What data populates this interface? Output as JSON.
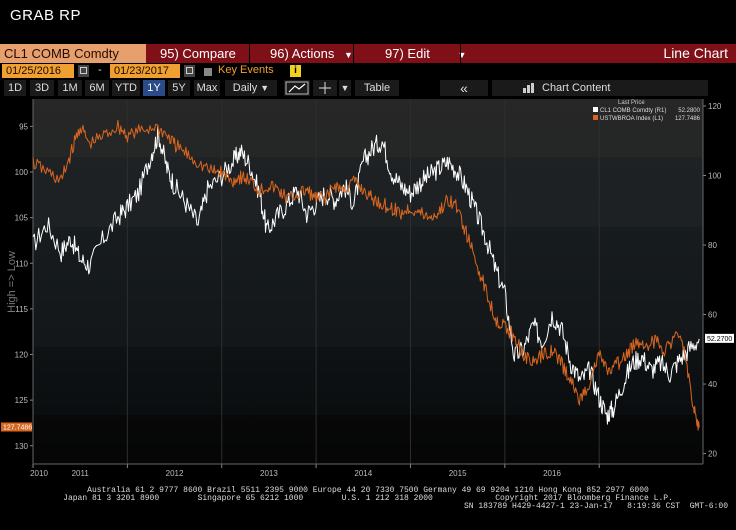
{
  "title": "GRAB RP",
  "command_bar": {
    "ticker": "CL1 COMB Comdty",
    "compare_num": "95)",
    "compare_label": "Compare",
    "actions_num": "96)",
    "actions_label": "Actions",
    "edit_num": "97)",
    "edit_label": "Edit",
    "view_label": "Line Chart"
  },
  "date_row": {
    "start_date": "01/25/2016",
    "end_date": "01/23/2017",
    "dash": "-",
    "key_events_label": "Key Events",
    "info_icon_glyph": "i"
  },
  "toolbar": {
    "ranges": [
      "1D",
      "3D",
      "1M",
      "6M",
      "YTD",
      "1Y",
      "5Y",
      "Max"
    ],
    "active_range": "1Y",
    "frequency": "Daily",
    "table_label": "Table",
    "collapse_glyph": "«",
    "chart_content_label": "Chart Content"
  },
  "legend": {
    "header": "Last Price",
    "items": [
      {
        "label": "CL1 COMB Comdty (R1)",
        "value": "52.2800",
        "color": "#ffffff"
      },
      {
        "label": "USTWBROA Index (L1)",
        "value": "127.7486",
        "color": "#d9661f"
      }
    ]
  },
  "axis_title_left": "High => Low",
  "last_value_tags": {
    "left": "127.7486",
    "right": "52.2700"
  },
  "footer": {
    "line1": "Australia 61 2 9777 8600 Brazil 5511 2395 9000 Europe 44 20 7330 7500 Germany 49 69 9204 1210 Hong Kong 852 2977 6000",
    "line2": "Japan 81 3 3201 8900        Singapore 65 6212 1000        U.S. 1 212 318 2000             Copyright 2017 Bloomberg Finance L.P.",
    "line3": "SN 183789 H429-4427-1 23-Jan-17   8:19:36 CST  GMT-6:00"
  },
  "colors": {
    "cmd_bar": "#7f1018",
    "ticker_bg": "#e6a06e",
    "date_bg": "#f0a030",
    "series_oil": "#ffffff",
    "series_dollar": "#d9661f"
  },
  "chart_data": {
    "type": "line",
    "x_ticks": [
      "2010",
      "2011",
      "2012",
      "2013",
      "2014",
      "2015",
      "2016"
    ],
    "left_axis": {
      "label": "High => Low",
      "inverted": true,
      "ticks": [
        95,
        100,
        105,
        110,
        115,
        120,
        125,
        130
      ],
      "range": [
        92,
        132
      ]
    },
    "right_axis": {
      "ticks": [
        20,
        40,
        60,
        80,
        100,
        120
      ],
      "range": [
        17,
        122
      ]
    },
    "series": [
      {
        "name": "CL1 COMB Comdty (R1)",
        "axis": "right",
        "color": "#ffffff",
        "x": [
          2010.0,
          2010.15,
          2010.3,
          2010.4,
          2010.5,
          2010.6,
          2010.75,
          2010.9,
          2011.0,
          2011.12,
          2011.25,
          2011.33,
          2011.42,
          2011.5,
          2011.62,
          2011.75,
          2011.85,
          2012.0,
          2012.12,
          2012.2,
          2012.3,
          2012.4,
          2012.48,
          2012.58,
          2012.7,
          2012.8,
          2012.9,
          2013.0,
          2013.1,
          2013.2,
          2013.3,
          2013.4,
          2013.5,
          2013.6,
          2013.7,
          2013.8,
          2013.9,
          2014.0,
          2014.1,
          2014.2,
          2014.3,
          2014.4,
          2014.5,
          2014.6,
          2014.7,
          2014.8,
          2014.9,
          2015.0,
          2015.1,
          2015.2,
          2015.3,
          2015.4,
          2015.5,
          2015.6,
          2015.7,
          2015.8,
          2015.9,
          2016.0,
          2016.08,
          2016.15,
          2016.25,
          2016.35,
          2016.45,
          2016.55,
          2016.65,
          2016.75,
          2016.85,
          2016.95,
          2017.06
        ],
        "y": [
          80,
          86,
          78,
          82,
          76,
          74,
          82,
          88,
          91,
          95,
          106,
          112,
          102,
          97,
          92,
          86,
          96,
          100,
          104,
          107,
          103,
          95,
          84,
          88,
          92,
          96,
          89,
          92,
          95,
          93,
          97,
          92,
          104,
          108,
          110,
          101,
          97,
          95,
          98,
          100,
          102,
          104,
          101,
          96,
          89,
          82,
          73,
          66,
          48,
          50,
          57,
          52,
          60,
          56,
          46,
          41,
          44,
          36,
          31,
          33,
          40,
          46,
          48,
          44,
          46,
          43,
          47,
          50,
          53
        ]
      },
      {
        "name": "USTWBROA Index (L1)",
        "axis": "left",
        "color": "#d9661f",
        "x": [
          2010.0,
          2010.15,
          2010.3,
          2010.4,
          2010.5,
          2010.6,
          2010.75,
          2010.9,
          2011.0,
          2011.15,
          2011.3,
          2011.42,
          2011.5,
          2011.62,
          2011.75,
          2011.9,
          2012.0,
          2012.1,
          2012.2,
          2012.3,
          2012.4,
          2012.5,
          2012.6,
          2012.7,
          2012.8,
          2012.9,
          2013.0,
          2013.1,
          2013.2,
          2013.3,
          2013.4,
          2013.5,
          2013.6,
          2013.7,
          2013.8,
          2013.9,
          2014.0,
          2014.1,
          2014.2,
          2014.3,
          2014.4,
          2014.5,
          2014.6,
          2014.7,
          2014.8,
          2014.9,
          2015.0,
          2015.1,
          2015.2,
          2015.3,
          2015.4,
          2015.5,
          2015.6,
          2015.7,
          2015.8,
          2015.9,
          2016.0,
          2016.1,
          2016.2,
          2016.3,
          2016.4,
          2016.5,
          2016.6,
          2016.7,
          2016.8,
          2016.9,
          2017.0,
          2017.06
        ],
        "y": [
          99,
          100,
          101,
          98,
          95,
          97,
          96,
          95,
          96,
          95.5,
          95,
          96,
          97,
          98,
          99,
          100,
          100,
          101,
          100.5,
          101,
          102,
          101.5,
          102,
          103,
          102.5,
          102,
          103,
          102.8,
          101.5,
          102,
          101,
          102,
          103,
          103.5,
          104,
          104.5,
          104,
          104.5,
          105,
          104.5,
          103,
          104,
          107,
          110,
          113,
          116,
          117,
          118,
          120,
          121,
          120,
          119.5,
          121,
          123,
          125,
          123,
          120,
          122,
          121,
          120,
          118.5,
          119,
          118.5,
          119.5,
          118,
          119,
          126,
          128
        ]
      }
    ]
  }
}
